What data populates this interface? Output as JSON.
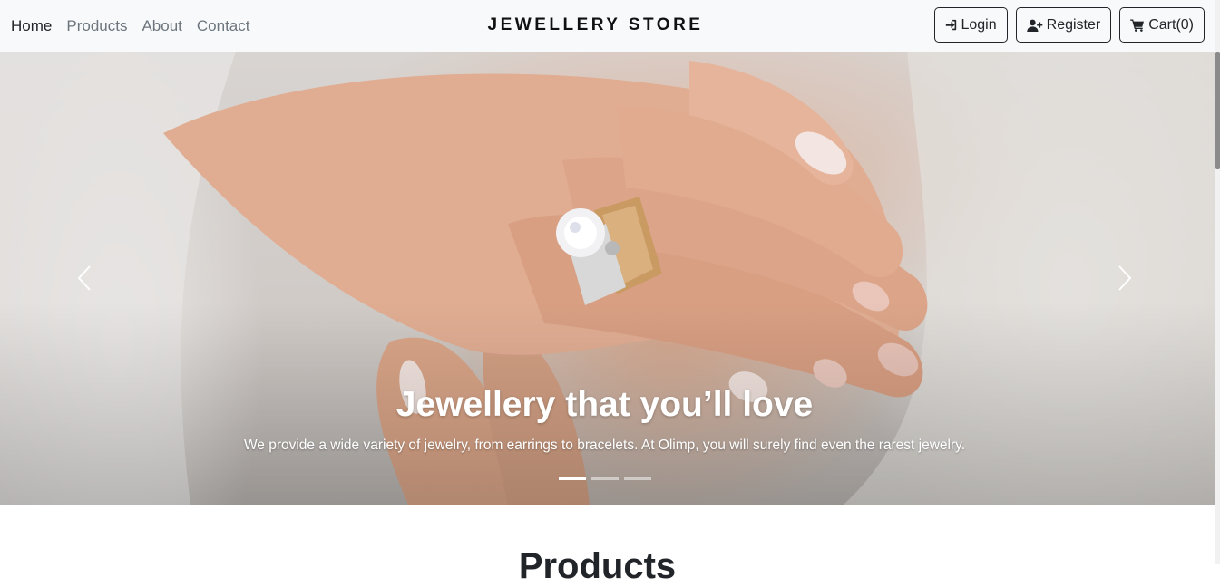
{
  "nav": {
    "links": [
      {
        "label": "Home",
        "active": true
      },
      {
        "label": "Products"
      },
      {
        "label": "About"
      },
      {
        "label": "Contact"
      }
    ],
    "brand": "JEWELLERY STORE",
    "login_label": "Login",
    "register_label": "Register",
    "cart_label": "Cart(0)"
  },
  "carousel": {
    "title": "Jewellery that you’ll love",
    "description": "We provide a wide variety of jewelry, from earrings to bracelets. At Olimp, you will surely find even the rarest jewelry.",
    "slide_count": 3,
    "active_slide": 1
  },
  "section": {
    "title": "Products"
  },
  "icons": {
    "login": "sign-in-icon",
    "register": "user-plus-icon",
    "cart": "shopping-cart-icon",
    "prev": "chevron-left-icon",
    "next": "chevron-right-icon"
  }
}
